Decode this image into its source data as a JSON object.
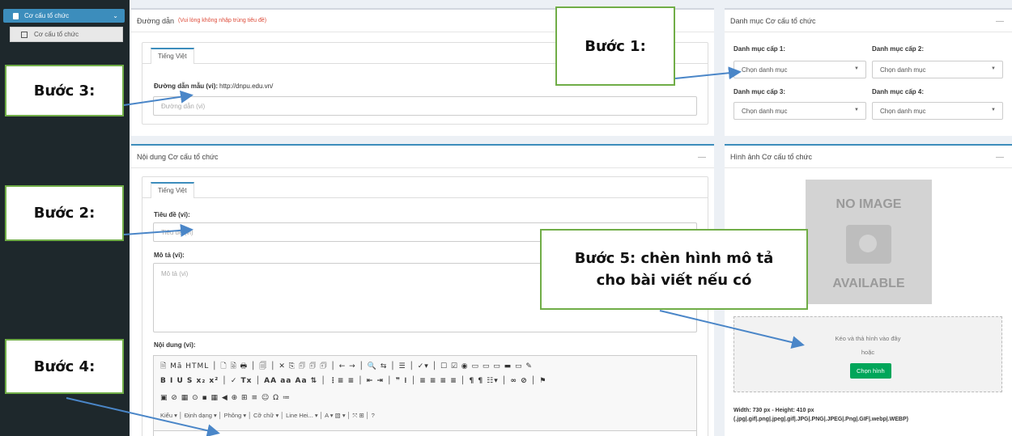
{
  "sidebar": {
    "active_item": "Cơ cấu tổ chức",
    "sub_item": "Cơ cấu tổ chức"
  },
  "path_box": {
    "title": "Đường dẫn",
    "note": "(Vui lòng không nhập trùng tiêu đề)",
    "tab": "Tiếng Việt",
    "sample_label": "Đường dẫn mẫu (vi):",
    "sample_url": "http://dnpu.edu.vn/",
    "placeholder": "Đường dẫn (vi)"
  },
  "content_box": {
    "title": "Nội dung Cơ cấu tổ chức",
    "tab": "Tiếng Việt",
    "title_label": "Tiêu đề (vi):",
    "title_placeholder": "Tiêu đề (vi)",
    "desc_label": "Mô tả (vi):",
    "desc_placeholder": "Mô tả (vi)",
    "content_label": "Nội dung (vi):"
  },
  "editor_toolbar": {
    "row1": "🗎 Mã HTML │ 🗋 🗟 🖶 │ 🗐 │ ✕ ⎘ 🗊 🗊 🗊 │ ← → │ 🔍 ⇆ │ ☰ │ ✓▾ │ ☐ ☑ ◉ ▭ ▭ ▭ ▬ ▭ ✎",
    "row2": "B  I  U  S  x₂  x²  │ ✓  Tx │ AA aa Aa ⇅ │ ⋮≡ ≡ │ ⇤ ⇥ │ ❞ ⁝ │ ≡ ≡ ≡ ≡ │ ¶ ¶ ☷▾ │ ∞ ⊘ │ ⚑",
    "row3": "▣ ⊘ ▦ ⊙ ▪ ▦ ◀ ⊕ ⊞ ≡ ☺ Ω ≔",
    "row4": "Kiểu      ▾ │ Định dạng  ▾ │ Phông       ▾ │ Cỡ chữ      ▾ │ Line Hei...  ▾ │ A ▾ ▧ ▾ │ ⤧ ⊞ │ ?"
  },
  "category_box": {
    "title": "Danh mục Cơ cấu tổ chức",
    "fields": [
      {
        "label": "Danh mục cấp 1:",
        "value": "Chọn danh mục"
      },
      {
        "label": "Danh mục cấp 2:",
        "value": "Chọn danh mục"
      },
      {
        "label": "Danh mục cấp 3:",
        "value": "Chọn danh mục"
      },
      {
        "label": "Danh mục cấp 4:",
        "value": "Chọn danh mục"
      }
    ]
  },
  "image_box": {
    "title": "Hình ảnh Cơ cấu tổ chức",
    "noimage_top": "NO IMAGE",
    "noimage_bottom": "AVAILABLE",
    "drop_text": "Kéo và thả hình vào đây",
    "or_text": "hoặc",
    "choose_button": "Chọn hình",
    "size_text": "Width: 730 px - Height: 410 px",
    "format_text": "(.jpg|.gif|.png|.jpeg|.gif|.JPG|.PNG|.JPEG|.Png|.GIF|.webp|.WEBP)"
  },
  "callouts": {
    "step1": "Bước 1:",
    "step2": "Bước 2:",
    "step3": "Bước 3:",
    "step4": "Bước 4:",
    "step5_line1": "Bước 5: chèn hình mô tả",
    "step5_line2": "cho bài viết nếu có"
  },
  "colors": {
    "primary": "#3c8dbc",
    "callout_border": "#70ad47",
    "arrow": "#4a86c8",
    "button_green": "#00a65a",
    "note_red": "#dd4b39"
  }
}
